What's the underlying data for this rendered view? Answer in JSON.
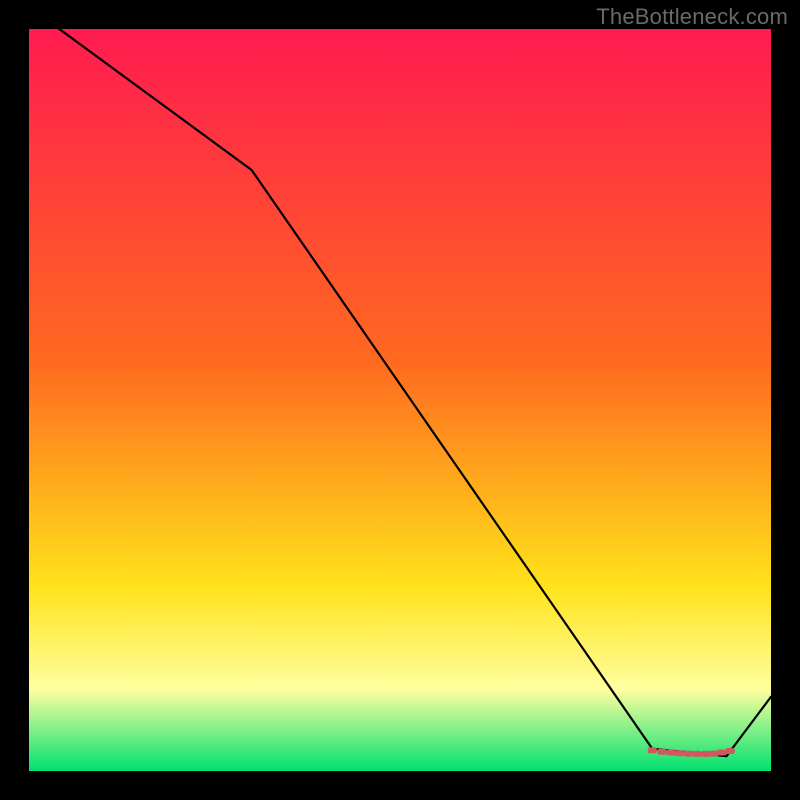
{
  "watermark": "TheBottleneck.com",
  "colors": {
    "top": "#ff1a50",
    "mid1": "#ff6a1f",
    "mid2": "#ffe21a",
    "low": "#ffff9f",
    "bottom": "#00e070",
    "line": "#000000",
    "marker": "#d4565f"
  },
  "chart_data": {
    "type": "line",
    "title": "",
    "xlabel": "",
    "ylabel": "",
    "xlim": [
      0,
      100
    ],
    "ylim": [
      0,
      100
    ],
    "x": [
      0,
      30,
      84,
      94,
      100
    ],
    "y": [
      103,
      81,
      3,
      2,
      10
    ],
    "markers": {
      "x": [
        84,
        85.3,
        86.5,
        87.6,
        88.8,
        90,
        91.2,
        92.3,
        93.4,
        94.5
      ],
      "y": [
        2.8,
        2.6,
        2.5,
        2.4,
        2.35,
        2.3,
        2.3,
        2.35,
        2.5,
        2.7
      ]
    },
    "gradient_stops": [
      {
        "offset": 0.0,
        "color_key": "top"
      },
      {
        "offset": 0.45,
        "color_key": "mid1"
      },
      {
        "offset": 0.75,
        "color_key": "mid2"
      },
      {
        "offset": 0.89,
        "color_key": "low"
      },
      {
        "offset": 1.0,
        "color_key": "bottom"
      }
    ]
  }
}
